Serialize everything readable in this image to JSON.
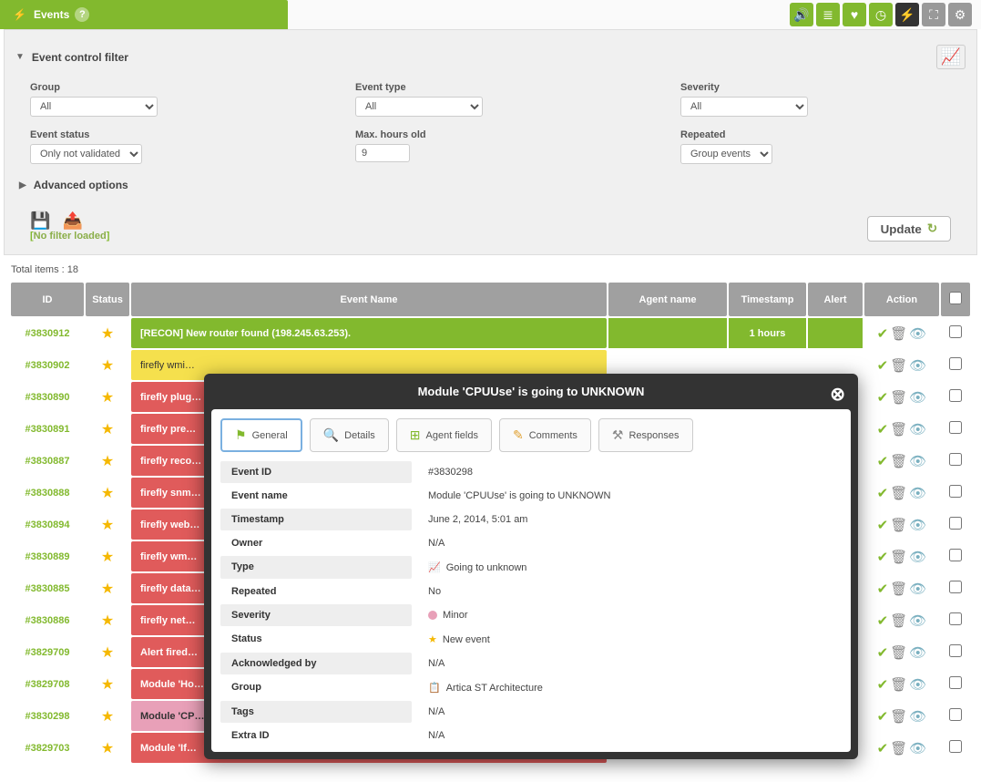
{
  "header": {
    "title": "Events",
    "icons": [
      {
        "name": "sound-icon",
        "glyph": "🔊",
        "class": ""
      },
      {
        "name": "list-icon",
        "glyph": "≣",
        "class": ""
      },
      {
        "name": "heart-icon",
        "glyph": "♥",
        "class": ""
      },
      {
        "name": "rss-icon",
        "glyph": "◷",
        "class": ""
      },
      {
        "name": "flash-icon",
        "glyph": "⚡",
        "class": "dark"
      },
      {
        "name": "fullscreen-icon",
        "glyph": "⛶",
        "class": "grey"
      },
      {
        "name": "gear-icon",
        "glyph": "⚙",
        "class": "grey"
      }
    ]
  },
  "filter": {
    "section_title": "Event control filter",
    "group_label": "Group",
    "group_value": "All",
    "event_type_label": "Event type",
    "event_type_value": "All",
    "severity_label": "Severity",
    "severity_value": "All",
    "event_status_label": "Event status",
    "event_status_value": "Only not validated",
    "max_hours_label": "Max. hours old",
    "max_hours_value": "9",
    "repeated_label": "Repeated",
    "repeated_value": "Group events",
    "advanced_label": "Advanced options",
    "no_filter_text": "No filter loaded",
    "update_label": "Update"
  },
  "total_items": "Total items : 18",
  "columns": {
    "id": "ID",
    "status": "Status",
    "event_name": "Event Name",
    "agent_name": "Agent name",
    "timestamp": "Timestamp",
    "alert": "Alert",
    "action": "Action"
  },
  "rows": [
    {
      "id": "#3830912",
      "name": "[RECON] New router found (198.245.63.253).",
      "class": "green",
      "ts": "1 hours"
    },
    {
      "id": "#3830902",
      "name": "firefly wmi…",
      "class": "yellow",
      "ts": ""
    },
    {
      "id": "#3830890",
      "name": "firefly plug…",
      "class": "red",
      "ts": ""
    },
    {
      "id": "#3830891",
      "name": "firefly pre…",
      "class": "red",
      "ts": ""
    },
    {
      "id": "#3830887",
      "name": "firefly reco…",
      "class": "red",
      "ts": ""
    },
    {
      "id": "#3830888",
      "name": "firefly snm…",
      "class": "red",
      "ts": ""
    },
    {
      "id": "#3830894",
      "name": "firefly web…",
      "class": "red",
      "ts": ""
    },
    {
      "id": "#3830889",
      "name": "firefly wm…",
      "class": "red",
      "ts": ""
    },
    {
      "id": "#3830885",
      "name": "firefly data…",
      "class": "red",
      "ts": ""
    },
    {
      "id": "#3830886",
      "name": "firefly net…",
      "class": "red",
      "ts": ""
    },
    {
      "id": "#3829709",
      "name": "Alert fired…",
      "class": "red",
      "ts": ""
    },
    {
      "id": "#3829708",
      "name": "Module 'Ho…",
      "class": "red",
      "ts": ""
    },
    {
      "id": "#3830298",
      "name": "Module 'CP…",
      "class": "pink",
      "ts": ""
    },
    {
      "id": "#3829703",
      "name": "Module 'If…",
      "class": "red",
      "ts": ""
    }
  ],
  "modal": {
    "title": "Module 'CPUUse' is going to UNKNOWN",
    "tabs": {
      "general": "General",
      "details": "Details",
      "agent_fields": "Agent fields",
      "comments": "Comments",
      "responses": "Responses"
    },
    "fields": [
      {
        "label": "Event ID",
        "value": "#3830298"
      },
      {
        "label": "Event name",
        "value": "Module 'CPUUse' is going to UNKNOWN"
      },
      {
        "label": "Timestamp",
        "value": "June 2, 2014, 5:01 am"
      },
      {
        "label": "Owner",
        "value": "N/A"
      },
      {
        "label": "Type",
        "value": "Going to unknown",
        "icon": "📈"
      },
      {
        "label": "Repeated",
        "value": "No"
      },
      {
        "label": "Severity",
        "value": "Minor",
        "dot": true
      },
      {
        "label": "Status",
        "value": "New event",
        "star": true
      },
      {
        "label": "Acknowledged by",
        "value": "N/A"
      },
      {
        "label": "Group",
        "value": "Artica ST Architecture",
        "icon": "📋"
      },
      {
        "label": "Tags",
        "value": "N/A"
      },
      {
        "label": "Extra ID",
        "value": "N/A"
      }
    ]
  }
}
